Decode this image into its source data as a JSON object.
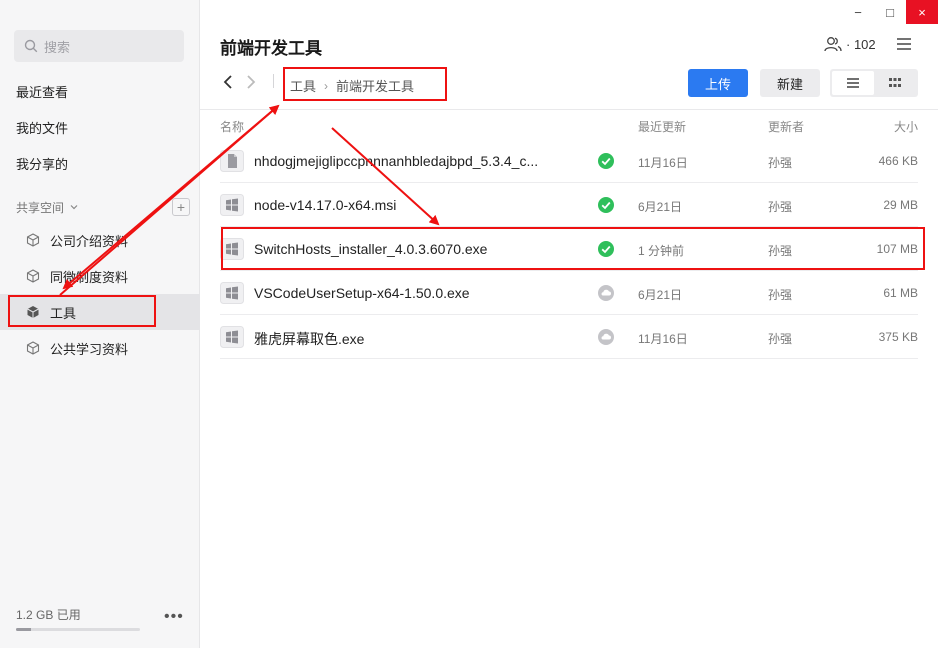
{
  "window": {
    "minimize": "−",
    "maximize": "□",
    "close": "×"
  },
  "sidebar": {
    "search_placeholder": "搜索",
    "nav": [
      {
        "label": "最近查看"
      },
      {
        "label": "我的文件"
      },
      {
        "label": "我分享的"
      }
    ],
    "section_label": "共享空间",
    "add_label": "+",
    "spaces": [
      {
        "label": "公司介绍资料"
      },
      {
        "label": "同微制度资料"
      },
      {
        "label": "工具",
        "active": true
      },
      {
        "label": "公共学习资料"
      }
    ],
    "storage_used": "1.2 GB 已用",
    "storage_fraction": 0.12,
    "more_label": "•••"
  },
  "header": {
    "title": "前端开发工具",
    "member_count": "· 102",
    "breadcrumb": [
      "工具",
      "前端开发工具"
    ],
    "breadcrumb_sep": "›",
    "upload_label": "上传",
    "new_label": "新建"
  },
  "table": {
    "columns": {
      "name": "名称",
      "updated": "最近更新",
      "updater": "更新者",
      "size": "大小"
    },
    "rows": [
      {
        "name": "nhdogjmejiglipccpnnnanhbledajbpd_5.3.4_c...",
        "icon": "doc-icon",
        "status": "synced",
        "updated": "11月16日",
        "updater": "孙强",
        "size": "466 KB"
      },
      {
        "name": "node-v14.17.0-x64.msi",
        "icon": "windows-icon",
        "status": "synced",
        "updated": "6月21日",
        "updater": "孙强",
        "size": "29 MB"
      },
      {
        "name": "SwitchHosts_installer_4.0.3.6070.exe",
        "icon": "windows-icon",
        "status": "synced",
        "updated": "1 分钟前",
        "updater": "孙强",
        "size": "107 MB"
      },
      {
        "name": "VSCodeUserSetup-x64-1.50.0.exe",
        "icon": "windows-icon",
        "status": "cloud",
        "updated": "6月21日",
        "updater": "孙强",
        "size": "61 MB"
      },
      {
        "name": "雅虎屏幕取色.exe",
        "icon": "windows-icon",
        "status": "cloud",
        "updated": "11月16日",
        "updater": "孙强",
        "size": "375 KB"
      }
    ]
  },
  "colors": {
    "accent": "#2b7af1",
    "synced": "#2fbf5b",
    "cloud": "#c4c4c8",
    "annotation": "#e11111"
  }
}
